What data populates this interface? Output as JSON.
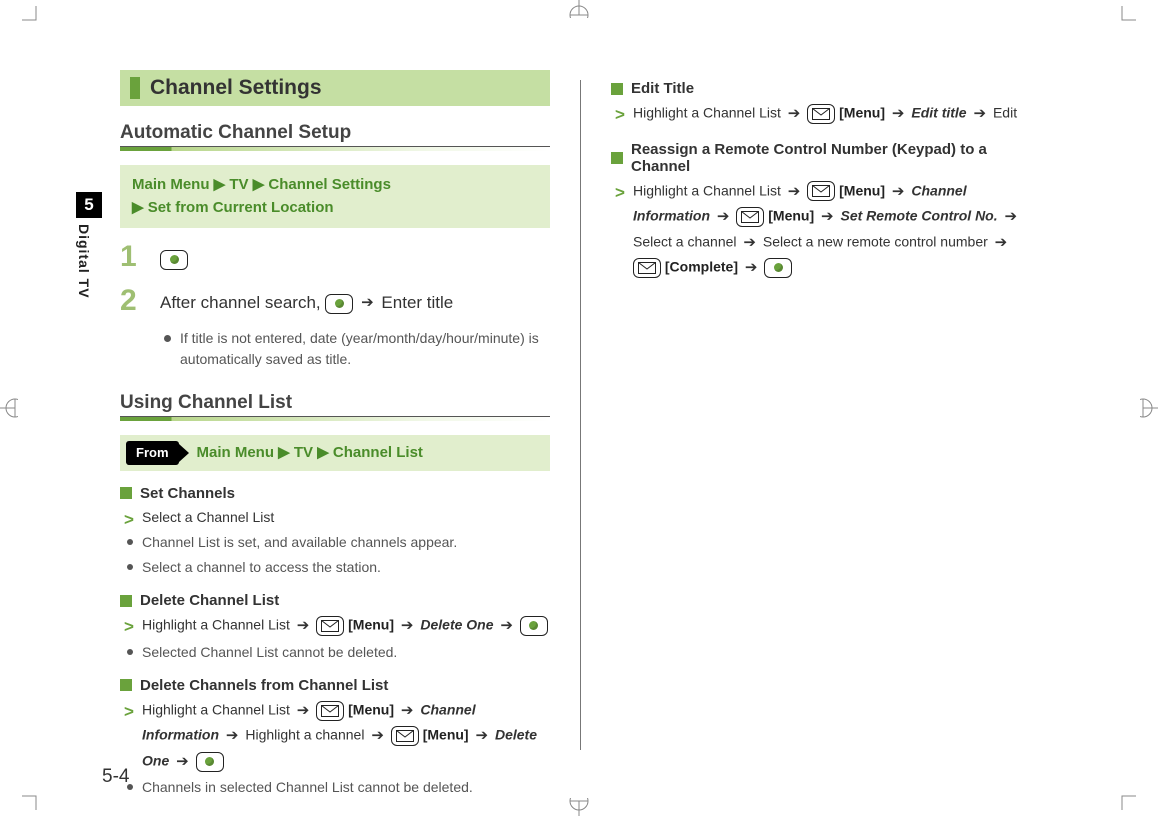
{
  "side": {
    "chapter": "5",
    "label": "Digital TV"
  },
  "banner": "Channel Settings",
  "left": {
    "sec1_title": "Automatic Channel Setup",
    "nav1_a": "Main Menu",
    "nav1_b": "TV",
    "nav1_c": "Channel Settings",
    "nav1_d": "Set from Current Location",
    "step1": "",
    "step2_a": "After channel search, ",
    "step2_b": " Enter title",
    "note2": "If title is not entered, date (year/month/day/hour/minute) is automatically saved as title.",
    "sec2_title": "Using Channel List",
    "from_label": "From",
    "nav2_a": "Main Menu",
    "nav2_b": "TV",
    "nav2_c": "Channel List",
    "set_channels": "Set Channels",
    "sc_action": "Select a Channel List",
    "sc_b1": "Channel List is set, and available channels appear.",
    "sc_b2": "Select a channel to access the station.",
    "del_list": "Delete Channel List",
    "dl_a1": "Highlight a Channel List ",
    "dl_menu": "[Menu]",
    "dl_delone": "Delete One",
    "dl_b1": "Selected Channel List cannot be deleted.",
    "del_ch": "Delete Channels from Channel List",
    "dc_a1": "Highlight a Channel List ",
    "dc_a2": " Highlight a channel ",
    "dc_ci": "Channel Information",
    "dc_b1": "Channels in selected Channel List cannot be deleted."
  },
  "right": {
    "edit_title": "Edit Title",
    "et_a1": "Highlight a Channel List ",
    "et_et": "Edit title",
    "et_edit": " Edit",
    "reassign": "Reassign a Remote Control Number (Keypad) to a Channel",
    "rc_a1": "Highlight a Channel List ",
    "rc_ci": "Channel Information",
    "rc_srcn": "Set Remote Control No.",
    "rc_sel": " Select a channel ",
    "rc_selnew": " Select a new remote control number ",
    "rc_complete": "[Complete]",
    "menu": "[Menu]"
  },
  "pagenum": "5-4"
}
